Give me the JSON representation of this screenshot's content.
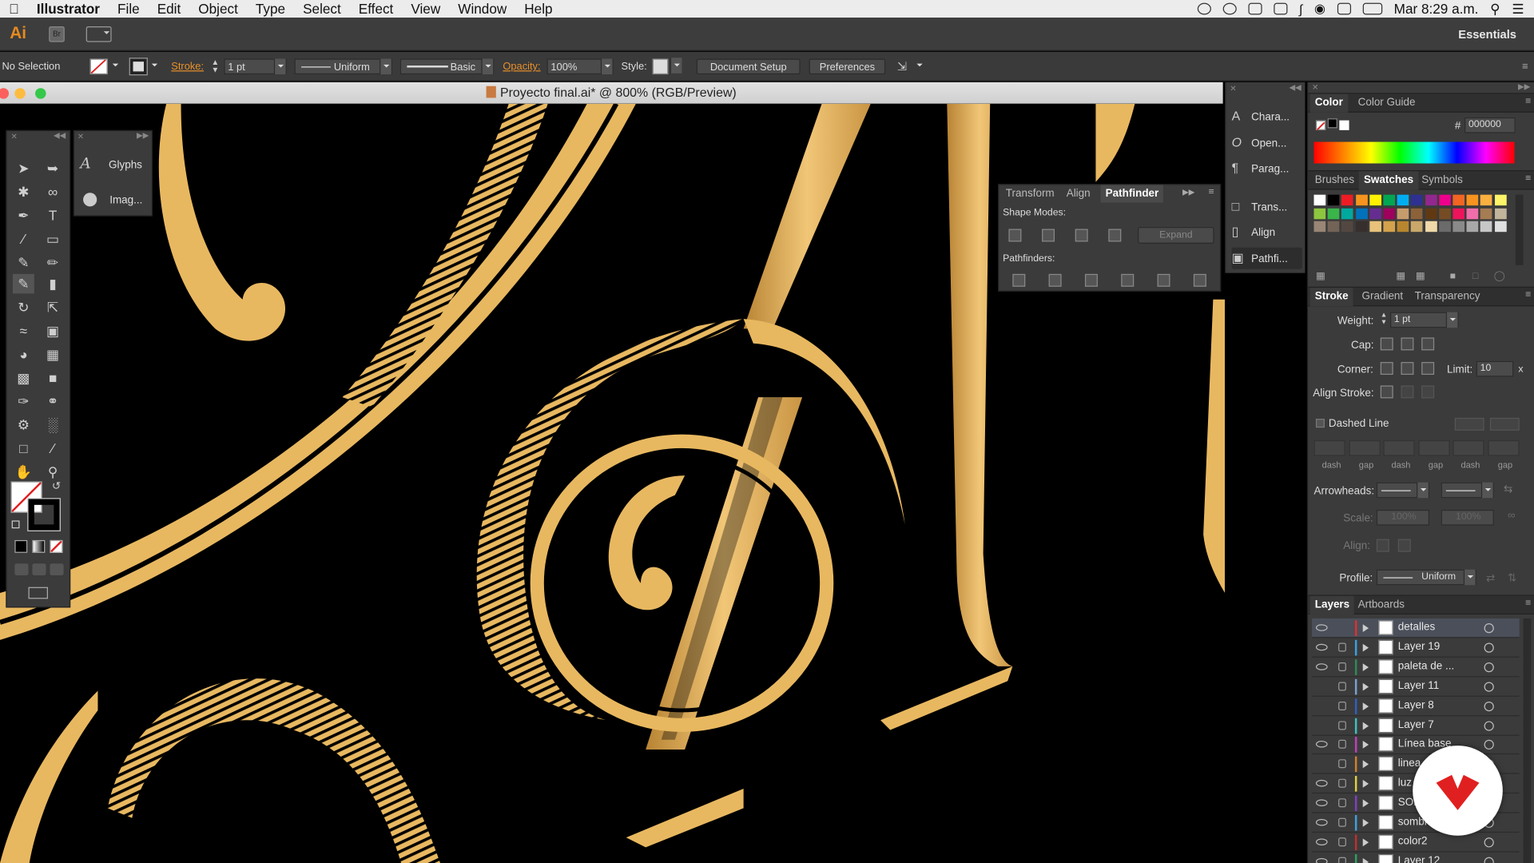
{
  "menubar": {
    "apple": "",
    "items": [
      "Illustrator",
      "File",
      "Edit",
      "Object",
      "Type",
      "Select",
      "Effect",
      "View",
      "Window",
      "Help"
    ],
    "clock": "Mar 8:29 a.m."
  },
  "appbar": {
    "logo": "Ai",
    "bridge": "Br",
    "workspace": "Essentials"
  },
  "control": {
    "selection": "No Selection",
    "stroke_label": "Stroke:",
    "stroke_weight": "1 pt",
    "profile_uniform": "Uniform",
    "brush_basic": "Basic",
    "opacity_label": "Opacity:",
    "opacity": "100%",
    "style_label": "Style:",
    "document_setup": "Document Setup",
    "preferences": "Preferences"
  },
  "document": {
    "title": "Proyecto final.ai* @ 800% (RGB/Preview)"
  },
  "glyphs_panel": {
    "items": [
      {
        "label": "Glyphs",
        "icon": "glyphs-icon"
      },
      {
        "label": "Imag...",
        "icon": "image-trace-icon"
      }
    ]
  },
  "pathfinder": {
    "tabs": [
      "Transform",
      "Align",
      "Pathfinder"
    ],
    "shape_modes": "Shape Modes:",
    "pathfinders": "Pathfinders:",
    "expand": "Expand"
  },
  "dock": {
    "items": [
      "Chara...",
      "Open...",
      "Parag...",
      "Trans...",
      "Align",
      "Pathfi..."
    ]
  },
  "color_panel": {
    "tabs": [
      "Color",
      "Color Guide"
    ],
    "hex_label": "#",
    "hex": "000000"
  },
  "swatches_panel": {
    "tabs": [
      "Brushes",
      "Swatches",
      "Symbols"
    ],
    "colors": [
      "#ffffff",
      "#000000",
      "#ed1c24",
      "#f7941d",
      "#fff200",
      "#00a651",
      "#00aeef",
      "#2e3192",
      "#92278f",
      "#ec008c",
      "#f26522",
      "#f7931e",
      "#fbb040",
      "#fff568",
      "#8dc63f",
      "#39b54a",
      "#00a99d",
      "#0072bc",
      "#662d91",
      "#9e005d",
      "#c69c6d",
      "#8c6239",
      "#603913",
      "#754c24",
      "#ed145b",
      "#f06eaa",
      "#a67c52",
      "#c2b59b",
      "#998675",
      "#736357",
      "#534741",
      "#362f2d",
      "#e8c27a",
      "#d4a24c",
      "#b8862e",
      "#c9a86a",
      "#f0d9a8",
      "#6b6b6b",
      "#8a8a8a",
      "#a8a8a8",
      "#c7c7c7",
      "#e0e0e0"
    ]
  },
  "stroke_panel": {
    "tabs": [
      "Stroke",
      "Gradient",
      "Transparency"
    ],
    "weight_label": "Weight:",
    "weight": "1 pt",
    "cap_label": "Cap:",
    "corner_label": "Corner:",
    "limit_label": "Limit:",
    "limit": "10",
    "limit_x": "x",
    "align_label": "Align Stroke:",
    "dashed_label": "Dashed Line",
    "dash_labels": [
      "dash",
      "gap",
      "dash",
      "gap",
      "dash",
      "gap"
    ],
    "arrowheads_label": "Arrowheads:",
    "scale_label": "Scale:",
    "scale1": "100%",
    "scale2": "100%",
    "align2_label": "Align:",
    "profile_label": "Profile:",
    "profile": "Uniform"
  },
  "layers_panel": {
    "tabs": [
      "Layers",
      "Artboards"
    ],
    "layers": [
      {
        "name": "detalles",
        "color": "#e03030",
        "eye": true,
        "lock": false,
        "selected": true
      },
      {
        "name": "Layer 19",
        "color": "#3aa0e0",
        "eye": true,
        "lock": true,
        "selected": false
      },
      {
        "name": "paleta de ...",
        "color": "#2e8b57",
        "eye": true,
        "lock": true,
        "selected": false
      },
      {
        "name": "Layer 11",
        "color": "#7aa0d0",
        "eye": false,
        "lock": true,
        "selected": false
      },
      {
        "name": "Layer 8",
        "color": "#3060c0",
        "eye": false,
        "lock": true,
        "selected": false
      },
      {
        "name": "Layer 7",
        "color": "#40c0c0",
        "eye": false,
        "lock": true,
        "selected": false
      },
      {
        "name": "Línea base",
        "color": "#c040c0",
        "eye": true,
        "lock": true,
        "selected": false
      },
      {
        "name": "linea",
        "color": "#d08030",
        "eye": false,
        "lock": true,
        "selected": false
      },
      {
        "name": "luz",
        "color": "#e0d040",
        "eye": true,
        "lock": true,
        "selected": false
      },
      {
        "name": "SOM",
        "color": "#8040c0",
        "eye": true,
        "lock": true,
        "selected": false
      },
      {
        "name": "sombra",
        "color": "#40a0e0",
        "eye": true,
        "lock": true,
        "selected": false
      },
      {
        "name": "color2",
        "color": "#c03030",
        "eye": true,
        "lock": true,
        "selected": false
      },
      {
        "name": "Layer 12",
        "color": "#30a060",
        "eye": true,
        "lock": true,
        "selected": false
      }
    ]
  },
  "colors": {
    "gold": "#e8b860",
    "gold_dark": "#b07c2c",
    "accent_orange": "#e8902a",
    "brand_red": "#e02020"
  }
}
